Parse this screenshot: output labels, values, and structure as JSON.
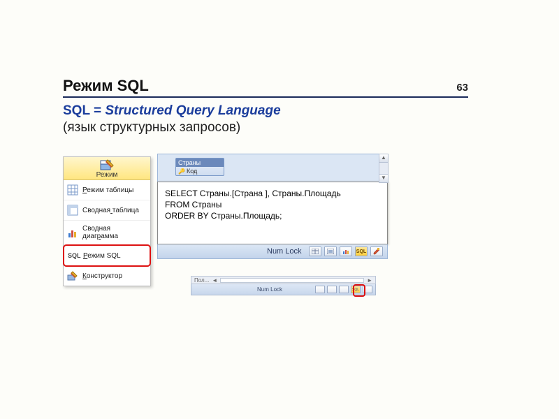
{
  "page_number": "63",
  "title": "Режим SQL",
  "subtitle_prefix": "SQL = ",
  "subtitle_expansion": "Structured Query Language",
  "subtitle_translation": "(язык структурных запросов)",
  "menu": {
    "top_label": "Режим",
    "items": [
      {
        "icon": "datasheet",
        "label": "Режим таблицы",
        "u": 0
      },
      {
        "icon": "pivot-table",
        "label": "Сводная таблица",
        "u": 7
      },
      {
        "icon": "pivot-chart",
        "label": "Сводная диаграмма",
        "u": 12
      },
      {
        "icon": "sql",
        "label": "Режим SQL",
        "u": 0,
        "highlight": true
      },
      {
        "icon": "design",
        "label": "Конструктор",
        "u": 0
      }
    ]
  },
  "table_box": {
    "title": "Страны",
    "key_field": "Код"
  },
  "sql": "SELECT Страны.[Страна ], Страны.Площадь\nFROM Страны\nORDER BY Страны.Площадь;",
  "status": {
    "numlock": "Num Lock",
    "sql_btn": "SQL"
  },
  "mini": {
    "scroll_label": "Пол...",
    "numlock": "Num Lock",
    "sql_btn": "SQL"
  }
}
